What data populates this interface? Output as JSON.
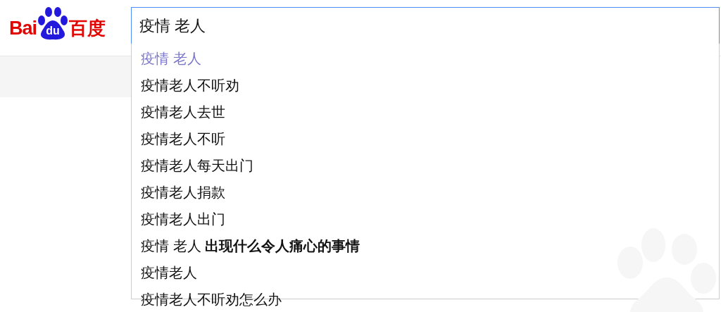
{
  "logo": {
    "left": "Bai",
    "paw": "du",
    "right": "百度"
  },
  "search": {
    "value": "疫情 老人"
  },
  "suggestions": [
    {
      "kind": "query",
      "text": "疫情 老人"
    },
    {
      "kind": "suggestion",
      "text": "疫情老人不听劝"
    },
    {
      "kind": "suggestion",
      "text": "疫情老人去世"
    },
    {
      "kind": "suggestion",
      "text": "疫情老人不听"
    },
    {
      "kind": "suggestion",
      "text": "疫情老人每天出门"
    },
    {
      "kind": "suggestion",
      "text": "疫情老人捐款"
    },
    {
      "kind": "suggestion",
      "text": "疫情老人出门"
    },
    {
      "kind": "suggestion",
      "text": "疫情 老人 **出现什么令人痛心的事情**"
    },
    {
      "kind": "suggestion",
      "text": "疫情老人"
    },
    {
      "kind": "suggestion",
      "text": "疫情老人不听劝怎么办"
    }
  ]
}
